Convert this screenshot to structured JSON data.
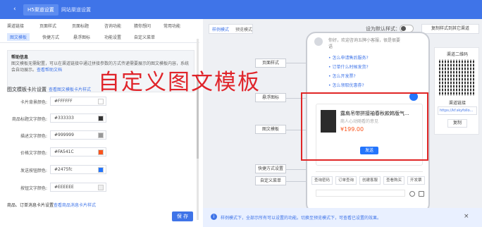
{
  "topbar": {
    "back_icon": "‹",
    "tabs": [
      "H5渠道设置",
      "网站渠道设置"
    ]
  },
  "left": {
    "nav_row1": [
      "渠道链接",
      "页面样式",
      "页面标题",
      "咨询功能",
      "猜你想问",
      "常用功能"
    ],
    "nav_row2": [
      "图文模板",
      "快捷方式",
      "悬浮图标",
      "功能设置",
      "自定义菜单"
    ],
    "help_title": "帮助信息",
    "help_text": "图文模板无需配置，可以在渠道链接中通过拼接参数的方式传递需要展示的图文模板内容，系统会自动展示。",
    "help_link": "查看帮助文档",
    "section_title": "图文模板卡片设置",
    "section_link": "查看图文模板卡片样式",
    "fields": [
      {
        "label": "卡片背景颜色:",
        "value": "#FFFFFF",
        "color": "#ffffff"
      },
      {
        "label": "商品标题文字颜色:",
        "value": "#333333",
        "color": "#333333"
      },
      {
        "label": "描述文字颜色:",
        "value": "#999999",
        "color": "#999999"
      },
      {
        "label": "价格文字颜色:",
        "value": "#FA541C",
        "color": "#fa541c"
      },
      {
        "label": "发送按钮颜色:",
        "value": "#2475fc",
        "color": "#2475fc"
      },
      {
        "label": "按钮文字颜色:",
        "value": "#EEEEEE",
        "color": "#eeeeee"
      }
    ],
    "bottom_text": "商品、订单消息卡片设置",
    "bottom_link": "查看商品消息卡片样式",
    "save_label": "保 存"
  },
  "right": {
    "mode_a": "样例模式",
    "mode_b": "预览模式",
    "default_label": "设为默认样式：",
    "copy_label": "复制样式到其它渠道",
    "tags": [
      "页面样式",
      "悬浮图标",
      "图文模板",
      "快捷方式设置",
      "自定义菜单"
    ],
    "greeting": "你好，欢迎咨询五牌小客服，很是很要语",
    "faqs": [
      "怎么申请售后服务?",
      "订单什么时候发货?",
      "怎么开发票?",
      "怎么领取优惠券?"
    ],
    "card": {
      "title": "露肩吊带拼接袖春秋款韩版气...",
      "desc": "商人心动随看的意见",
      "price": "¥199.00",
      "send": "发送"
    },
    "quick": [
      "查询密码",
      "订单查询",
      "创建客服",
      "查看购买",
      "开发票"
    ],
    "qr": {
      "title": "渠道二维码",
      "link_label": "渠道链接",
      "url": "https://kf.skyfollo...",
      "copy": "复制"
    }
  },
  "notice": {
    "icon": "i",
    "text": "样例模式下，全部示所有可以设置的功能。切换至预览模式下，可查看已设置的效果。",
    "close": "×"
  },
  "overlay": "自定义图文模板",
  "colors": {
    "accent": "#3f74e8",
    "price": "#fa541c",
    "button": "#2475fc",
    "highlight": "#e02626"
  }
}
